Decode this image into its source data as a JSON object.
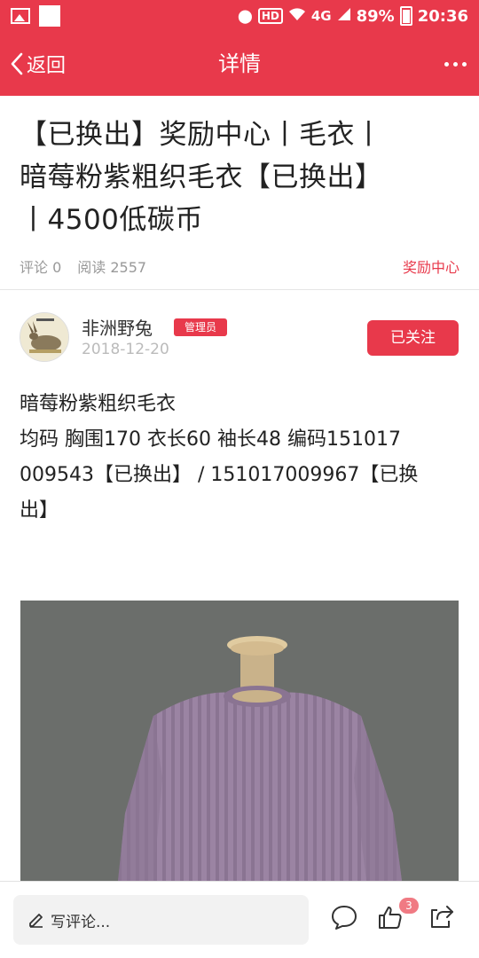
{
  "status_bar": {
    "battery": "89%",
    "time": "20:36",
    "hd_label": "HD",
    "network": "4G"
  },
  "navbar": {
    "back_label": "返回",
    "title": "详情"
  },
  "article": {
    "title_lines": [
      "【已换出】奖励中心丨毛衣丨",
      "暗莓粉紫粗织毛衣【已换出】",
      "丨4500低碳币"
    ],
    "comments": "评论 0",
    "reads": "阅读 2557",
    "category": "奖励中心"
  },
  "author": {
    "name": "非洲野兔",
    "badge": "管理员",
    "date": "2018-12-20",
    "follow_label": "已关注"
  },
  "content": {
    "lines": [
      "暗莓粉紫粗织毛衣",
      "均码  胸围170  衣长60  袖长48  编码151017",
      "009543【已换出】 / 151017009967【已换",
      "出】"
    ]
  },
  "bottom_bar": {
    "comment_placeholder": "写评论...",
    "like_count": "3"
  },
  "colors": {
    "brand": "#e8394b",
    "sweater": "#9b84a3",
    "photo_bg": "#6b6e6b"
  },
  "icons": [
    "back-chevron-icon",
    "more-icon",
    "pencil-icon",
    "comment-icon",
    "like-icon",
    "share-icon"
  ]
}
